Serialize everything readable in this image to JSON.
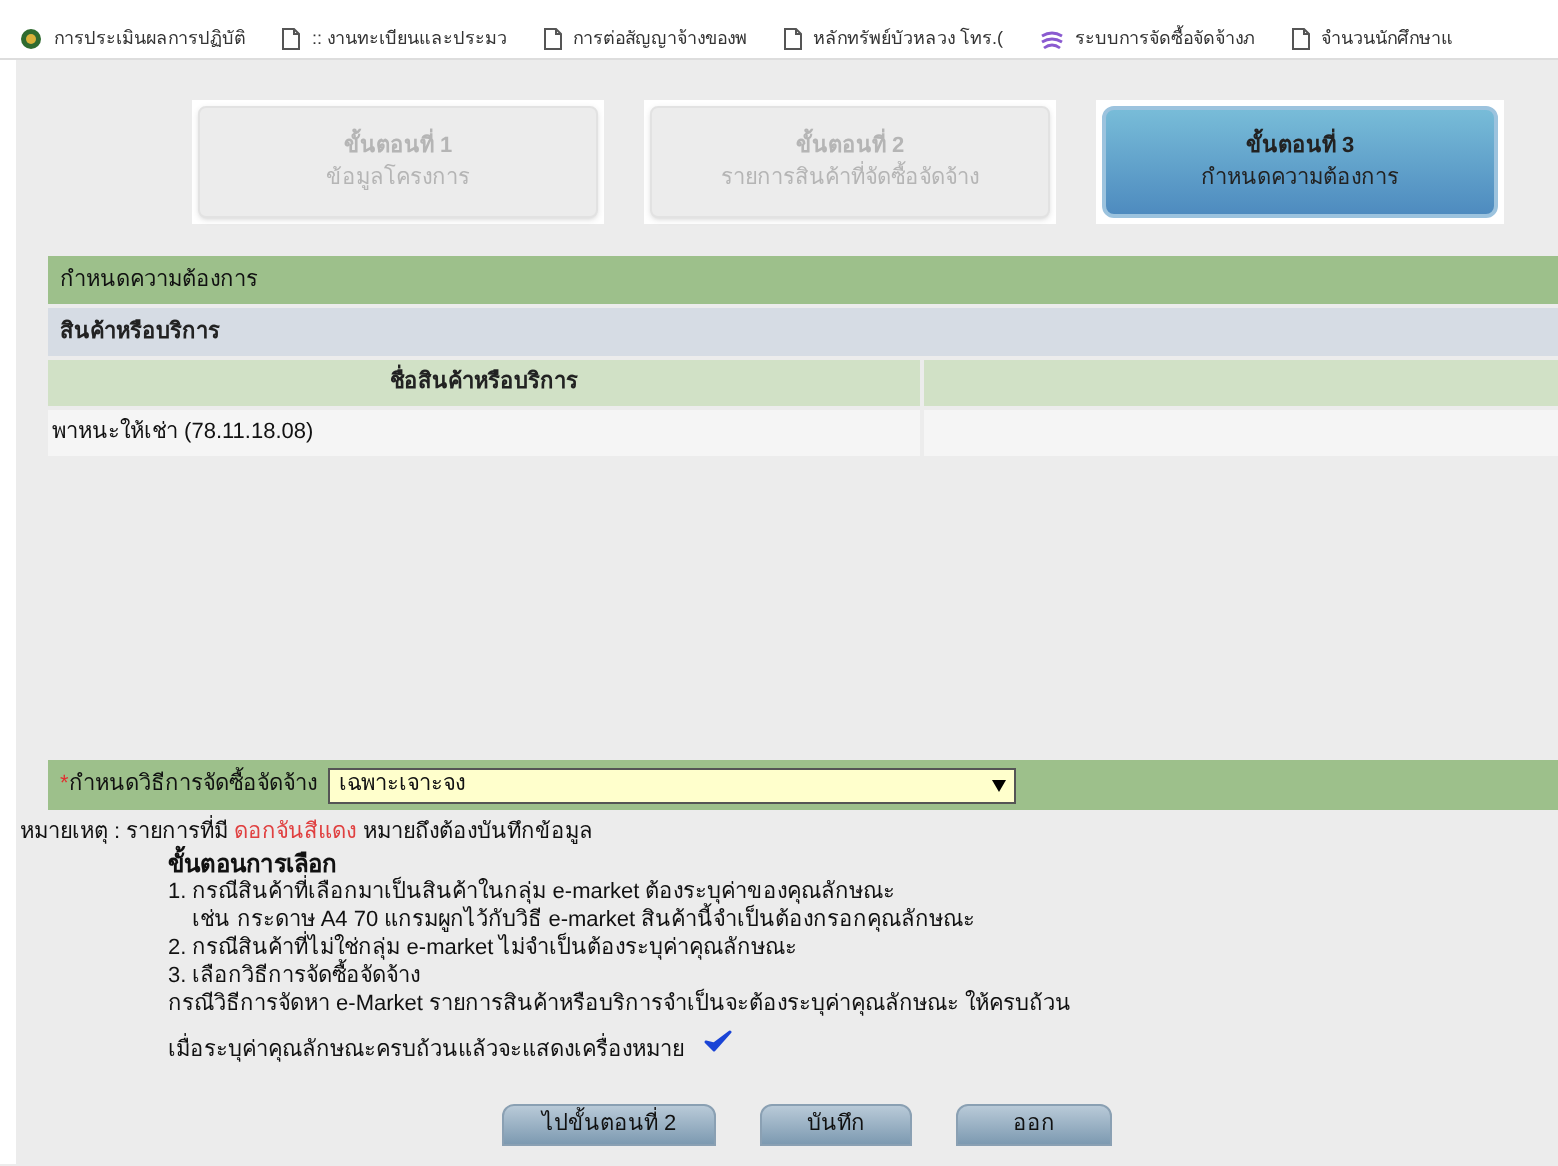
{
  "bookmarks": [
    {
      "label": "การประเมินผลการปฏิบัติ",
      "kind": "site"
    },
    {
      "label": ":: งานทะเบียนและประมว",
      "kind": "page"
    },
    {
      "label": "การต่อสัญญาจ้างของพ",
      "kind": "page"
    },
    {
      "label": "หลักทรัพย์บัวหลวง โทร.(",
      "kind": "page"
    },
    {
      "label": "ระบบการจัดซื้อจัดจ้างภ",
      "kind": "gov"
    },
    {
      "label": "จำนวนนักศึกษาแ",
      "kind": "page"
    }
  ],
  "steps": [
    {
      "title": "ขั้นตอนที่ 1",
      "subtitle": "ข้อมูลโครงการ",
      "selected": false
    },
    {
      "title": "ขั้นตอนที่ 2",
      "subtitle": "รายการสินค้าที่จัดซื้อจัดจ้าง",
      "selected": false
    },
    {
      "title": "ขั้นตอนที่ 3",
      "subtitle": "กำหนดความต้องการ",
      "selected": true
    }
  ],
  "section_title": "กำหนดความต้องการ",
  "subsection_title": "สินค้าหรือบริการ",
  "table": {
    "columns": [
      "ชื่อสินค้าหรือบริการ"
    ],
    "rows": [
      [
        "พาหนะให้เช่า (78.11.18.08)"
      ]
    ]
  },
  "method": {
    "required_mark": "*",
    "label": "กำหนดวิธีการจัดซื้อจัดจ้าง",
    "value": "เฉพาะเจาะจง"
  },
  "note_parts": {
    "before": "หมายเหตุ : รายการที่มี ",
    "highlight": "ดอกจันสีแดง",
    "after": " หมายถึงต้องบันทึกข้อมูล"
  },
  "instructions": {
    "title": "ขั้นตอนการเลือก",
    "lines": [
      "1. กรณีสินค้าที่เลือกมาเป็นสินค้าในกลุ่ม e-market ต้องระบุค่าของคุณลักษณะ",
      "    เช่น กระดาษ A4 70 แกรมผูกไว้กับวิธี e-market สินค้านี้จำเป็นต้องกรอกคุณลักษณะ",
      "2. กรณีสินค้าที่ไม่ใช่กลุ่ม e-market ไม่จำเป็นต้องระบุค่าคุณลักษณะ",
      "3. เลือกวิธีการจัดซื้อจัดจ้าง",
      "กรณีวิธีการจัดหา e-Market รายการสินค้าหรือบริการจำเป็นจะต้องระบุค่าคุณลักษณะ ให้ครบถ้วน"
    ],
    "check_line": "เมื่อระบุค่าคุณลักษณะครบถ้วนแล้วจะแสดงเครื่องหมาย"
  },
  "buttons": [
    "ไปขั้นตอนที่ 2",
    "บันทึก",
    "ออก"
  ]
}
